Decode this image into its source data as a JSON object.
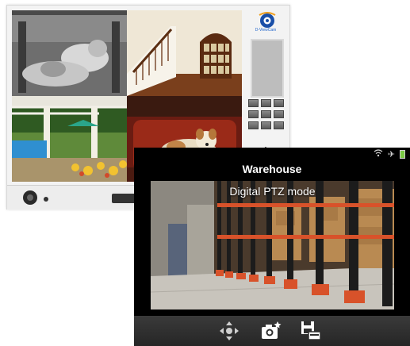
{
  "back_app": {
    "logo_text": "D-ViewCam"
  },
  "front_app": {
    "camera_name": "Warehouse",
    "overlay_text": "Digital PTZ mode",
    "toolbar": [
      {
        "icon": "ptz-move-icon"
      },
      {
        "icon": "snapshot-icon"
      },
      {
        "icon": "save-icon"
      }
    ]
  },
  "colors": {
    "battery": "#7ac943",
    "toolbar_bg": "#2f2f2f",
    "rack_orange": "#d8522a"
  }
}
